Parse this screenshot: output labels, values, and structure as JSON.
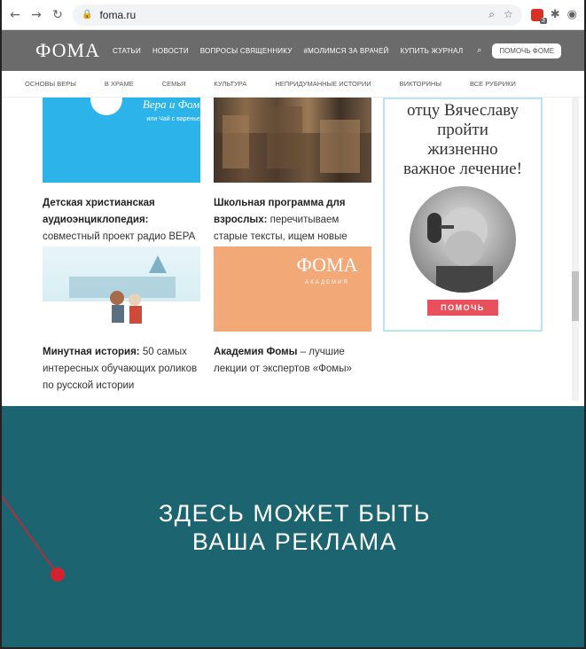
{
  "browser": {
    "url": "foma.ru",
    "icons": [
      "back-icon",
      "forward-icon",
      "reload-icon",
      "lock-icon",
      "zoom-icon",
      "star-icon",
      "extension-icon",
      "puzzle-icon",
      "account-icon"
    ],
    "extension_badge": "3"
  },
  "header": {
    "logo": "ФОМА",
    "nav": [
      "СТАТЬИ",
      "НОВОСТИ",
      "ВОПРОСЫ СВЯЩЕННИКУ",
      "#МОЛИМСЯ ЗА ВРАЧЕЙ",
      "КУПИТЬ ЖУРНАЛ"
    ],
    "help_button": "ПОМОЧЬ ФОМЕ"
  },
  "subnav": [
    "ОСНОВЫ ВЕРЫ",
    "В ХРАМЕ",
    "СЕМЬЯ",
    "КУЛЬТУРА",
    "НЕПРИДУМАННЫЕ ИСТОРИИ",
    "ВИКТОРИНЫ",
    "ВСЕ РУБРИКИ"
  ],
  "cards": [
    {
      "title": "Детская христианская аудиоэнциклопедия:",
      "text": " совместный проект радио ВЕРА и журнал Фома",
      "thumb_title": "Вера и Фома,",
      "thumb_sub": "или Чай с вареньем"
    },
    {
      "title": "Школьная программа для взрослых:",
      "text": " перечитываем старые тексты, ищем новые смыслы"
    },
    {
      "title": "Минутная история:",
      "text": " 50 самых интересных обучающих роликов по русской истории"
    },
    {
      "title": "Академия Фомы",
      "text": " – лучшие лекции от экспертов «Фомы»",
      "thumb_logo": "ФОМА",
      "thumb_sub": "АКАДЕМИЯ"
    }
  ],
  "aside": {
    "text_lines": [
      "отцу Вячеславу",
      "пройти",
      "жизненно",
      "важное лечение!"
    ],
    "button": "ПОМОЧЬ"
  },
  "ad": {
    "line1": "ЗДЕСЬ МОЖЕТ БЫТЬ",
    "line2": "ВАША РЕКЛАМА"
  },
  "colors": {
    "header_bg": "#6b6b6b",
    "ad_bg": "#1c6470",
    "accent_red": "#d7202e"
  }
}
